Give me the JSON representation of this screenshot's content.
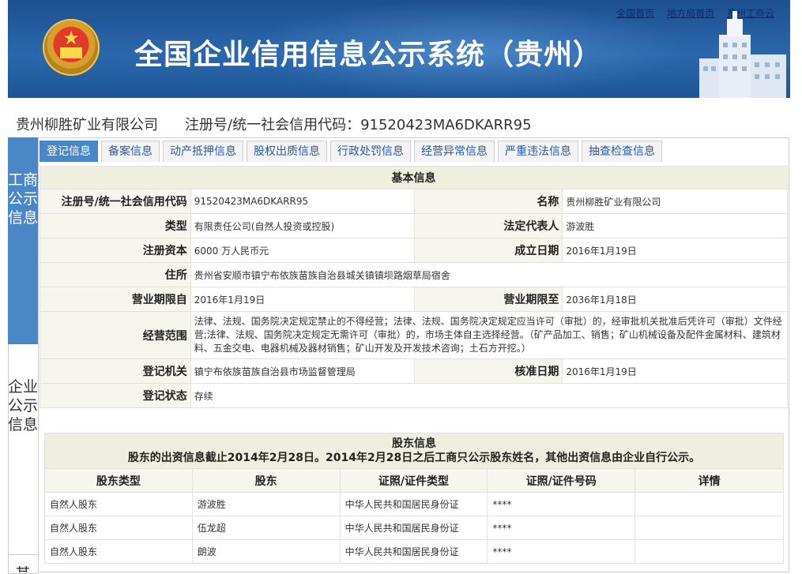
{
  "header": {
    "title": "全国企业信用信息公示系统（贵州）",
    "links": [
      "全国首页",
      "地方局首页",
      "贵州工商云"
    ]
  },
  "company": {
    "name": "贵州柳胜矿业有限公司",
    "reg_label": "注册号/统一社会信用代码：",
    "reg_no": "91520423MA6DKARR95"
  },
  "sidenav": {
    "items": [
      "工商公示信息",
      "企业公示信息",
      "其"
    ]
  },
  "tabs": [
    "登记信息",
    "备案信息",
    "动产抵押信息",
    "股权出质信息",
    "行政处罚信息",
    "经营异常信息",
    "严重违法信息",
    "抽查检查信息"
  ],
  "basic": {
    "title": "基本信息",
    "reg_label": "注册号/统一社会信用代码",
    "reg_value": "91520423MA6DKARR95",
    "name_label": "名称",
    "name_value": "贵州柳胜矿业有限公司",
    "type_label": "类型",
    "type_value": "有限责任公司(自然人投资或控股)",
    "rep_label": "法定代表人",
    "rep_value": "游波胜",
    "capital_label": "注册资本",
    "capital_value": "6000 万人民币元",
    "found_label": "成立日期",
    "found_value": "2016年1月19日",
    "address_label": "住所",
    "address_value": "贵州省安顺市镇宁布依族苗族自治县城关镇镇坝路烟草局宿舍",
    "term_from_label": "营业期限自",
    "term_from_value": "2016年1月19日",
    "term_to_label": "营业期限至",
    "term_to_value": "2036年1月18日",
    "scope_label": "经营范围",
    "scope_value": "法律、法规、国务院决定规定禁止的不得经营；法律、法规、国务院决定规定应当许可（审批）的，经审批机关批准后凭许可（审批）文件经营;法律、法规、国务院决定规定无需许可（审批）的，市场主体自主选择经营。（矿产品加工、销售；矿山机械设备及配件金属材料、建筑材料、五金交电、电器机械及器材销售；矿山开发及开发技术咨询；土石方开挖。）",
    "authority_label": "登记机关",
    "authority_value": "镇宁布依族苗族自治县市场监督管理局",
    "approve_label": "核准日期",
    "approve_value": "2016年1月19日",
    "status_label": "登记状态",
    "status_value": "存续"
  },
  "shareholders": {
    "title": "股东信息",
    "note": "股东的出资信息截止2014年2月28日。2014年2月28日之后工商只公示股东姓名，其他出资信息由企业自行公示。",
    "columns": [
      "股东类型",
      "股东",
      "证照/证件类型",
      "证照/证件号码",
      "详情"
    ],
    "rows": [
      {
        "type": "自然人股东",
        "name": "游波胜",
        "id_type": "中华人民共和国居民身份证",
        "id_no": "****",
        "detail": ""
      },
      {
        "type": "自然人股东",
        "name": "伍龙超",
        "id_type": "中华人民共和国居民身份证",
        "id_no": "****",
        "detail": ""
      },
      {
        "type": "自然人股东",
        "name": "朗波",
        "id_type": "中华人民共和国居民身份证",
        "id_no": "****",
        "detail": ""
      }
    ]
  }
}
